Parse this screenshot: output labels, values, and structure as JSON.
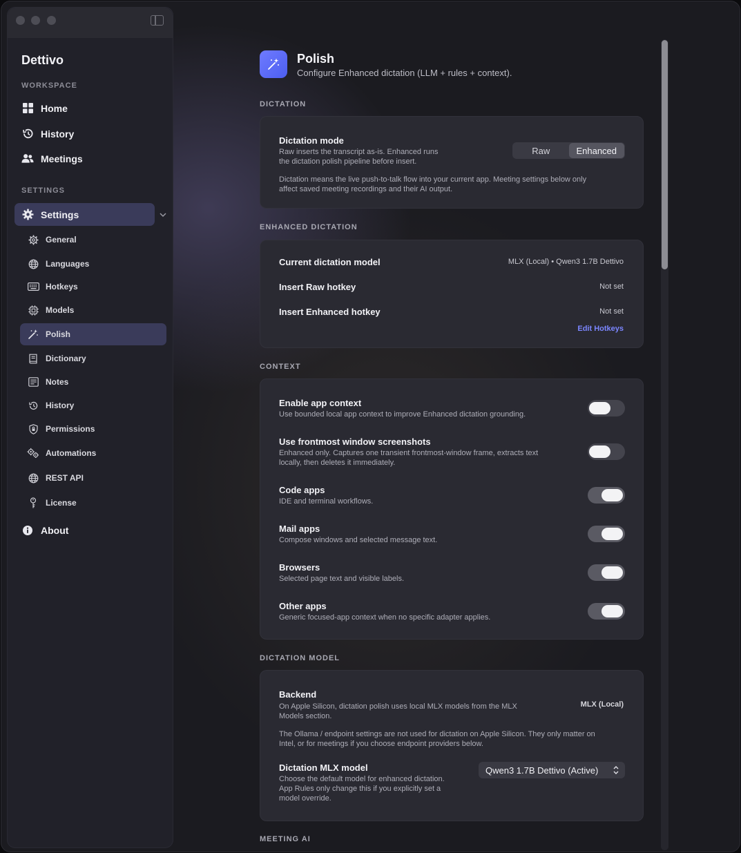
{
  "sidebar": {
    "app_title": "Dettivo",
    "workspace_label": "WORKSPACE",
    "settings_label": "SETTINGS",
    "workspace_items": [
      {
        "label": "Home",
        "icon": "grid-icon"
      },
      {
        "label": "History",
        "icon": "clock-icon"
      },
      {
        "label": "Meetings",
        "icon": "people-icon"
      }
    ],
    "settings_item": {
      "label": "Settings",
      "icon": "gear-icon"
    },
    "sub_items": [
      {
        "label": "General",
        "icon": "gear-icon"
      },
      {
        "label": "Languages",
        "icon": "globe-icon"
      },
      {
        "label": "Hotkeys",
        "icon": "keyboard-icon"
      },
      {
        "label": "Models",
        "icon": "chip-icon"
      },
      {
        "label": "Polish",
        "icon": "magic-wand-icon",
        "active": true
      },
      {
        "label": "Dictionary",
        "icon": "book-icon"
      },
      {
        "label": "Notes",
        "icon": "notes-icon"
      },
      {
        "label": "History",
        "icon": "clock-icon"
      },
      {
        "label": "Permissions",
        "icon": "shield-icon"
      },
      {
        "label": "Automations",
        "icon": "gears-icon"
      },
      {
        "label": "REST API",
        "icon": "globe-icon"
      },
      {
        "label": "License",
        "icon": "key-icon"
      }
    ],
    "about": {
      "label": "About",
      "icon": "info-icon"
    }
  },
  "header": {
    "title": "Polish",
    "subtitle": "Configure Enhanced dictation (LLM + rules + context).",
    "icon": "magic-wand-icon",
    "accent": "#5b68f6"
  },
  "dictation": {
    "label": "DICTATION",
    "mode_title": "Dictation mode",
    "mode_desc_1": "Raw inserts the transcript as-is. Enhanced runs",
    "mode_desc_2": "the dictation polish pipeline before insert.",
    "seg_raw": "Raw",
    "seg_enhanced": "Enhanced",
    "selected": "Enhanced",
    "note_1": "Dictation means the live push-to-talk flow into your current app. Meeting settings below only",
    "note_2": "affect saved meeting recordings and their AI output."
  },
  "enhanced": {
    "label": "ENHANCED DICTATION",
    "rows": [
      {
        "title": "Current dictation model",
        "value": "MLX (Local) • Qwen3 1.7B Dettivo"
      },
      {
        "title": "Insert Raw hotkey",
        "value": "Not set"
      },
      {
        "title": "Insert Enhanced hotkey",
        "value": "Not set"
      }
    ],
    "edit_link": "Edit Hotkeys",
    "link_color": "#7b86ff"
  },
  "context": {
    "label": "CONTEXT",
    "rows": [
      {
        "title": "Enable app context",
        "desc_1": "Use bounded local app context to improve Enhanced dictation grounding.",
        "desc_2": "",
        "on": false
      },
      {
        "title": "Use frontmost window screenshots",
        "desc_1": "Enhanced only. Captures one transient frontmost-window frame, extracts text",
        "desc_2": "locally, then deletes it immediately.",
        "on": false
      },
      {
        "title": "Code apps",
        "desc_1": "IDE and terminal workflows.",
        "desc_2": "",
        "on": true
      },
      {
        "title": "Mail apps",
        "desc_1": "Compose windows and selected message text.",
        "desc_2": "",
        "on": true
      },
      {
        "title": "Browsers",
        "desc_1": "Selected page text and visible labels.",
        "desc_2": "",
        "on": true
      },
      {
        "title": "Other apps",
        "desc_1": "Generic focused-app context when no specific adapter applies.",
        "desc_2": "",
        "on": true
      }
    ]
  },
  "dictation_model": {
    "label": "DICTATION MODEL",
    "backend_title": "Backend",
    "backend_desc_1": "On Apple Silicon, dictation polish uses local MLX models from the MLX",
    "backend_desc_2": "Models section.",
    "backend_value": "MLX (Local)",
    "note_1": "The Ollama / endpoint settings are not used for dictation on Apple Silicon. They only matter on",
    "note_2": "Intel, or for meetings if you choose endpoint providers below.",
    "mlx_title": "Dictation MLX model",
    "mlx_desc_1": "Choose the default model for enhanced dictation.",
    "mlx_desc_2": "App Rules only change this if you explicitly set a",
    "mlx_desc_3": "model override.",
    "mlx_selected": "Qwen3 1.7B Dettivo (Active)"
  },
  "meeting_ai": {
    "label": "MEETING AI"
  }
}
